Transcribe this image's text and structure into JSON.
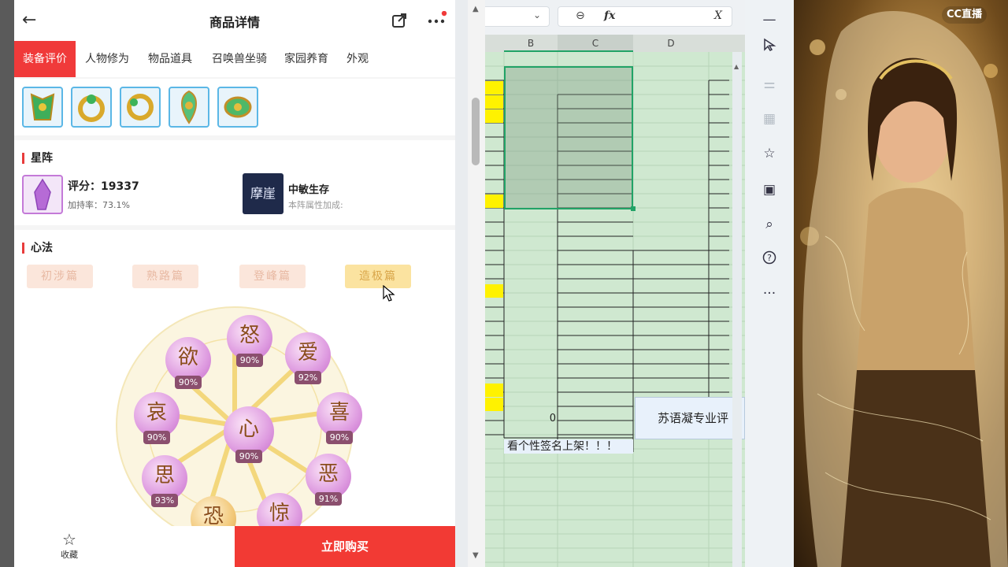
{
  "app": {
    "title": "商品详情",
    "categories": [
      "装备评价",
      "人物修为",
      "物品道具",
      "召唤兽坐骑",
      "家园养育",
      "外观"
    ]
  },
  "star": {
    "heading": "星阵",
    "score_label": "评分：19337",
    "bonus_label": "加持率：73.1%",
    "skill_name": "中敏生存",
    "skill_sub": "本阵属性加成:",
    "skill_icon_text": "摩崖"
  },
  "heart": {
    "heading": "心法",
    "tiers": [
      "初涉篇",
      "熟路篇",
      "登峰篇",
      "造极篇"
    ],
    "nodes": [
      {
        "char": "怒",
        "pct": "90%"
      },
      {
        "char": "欲",
        "pct": "90%"
      },
      {
        "char": "爱",
        "pct": "92%"
      },
      {
        "char": "哀",
        "pct": "90%"
      },
      {
        "char": "心",
        "pct": "90%"
      },
      {
        "char": "喜",
        "pct": "90%"
      },
      {
        "char": "思",
        "pct": "93%"
      },
      {
        "char": "恶",
        "pct": "91%"
      },
      {
        "char": "恐",
        "pct": ""
      },
      {
        "char": "惊",
        "pct": ""
      }
    ]
  },
  "bottom": {
    "fav_label": "收藏",
    "buy_label": "立即购买"
  },
  "sheet": {
    "columns": [
      "B",
      "C",
      "D"
    ],
    "cell_value": "0",
    "cell_text": "苏语凝专业评",
    "footer_text": "看个性签名上架！！！",
    "fx": "fx"
  },
  "watermark": "CC直播",
  "colors": {
    "accent_red": "#f03a3a",
    "sheet_green": "#cfe8d0",
    "highlight_yellow": "#fff200",
    "selection_border": "#21a366"
  }
}
